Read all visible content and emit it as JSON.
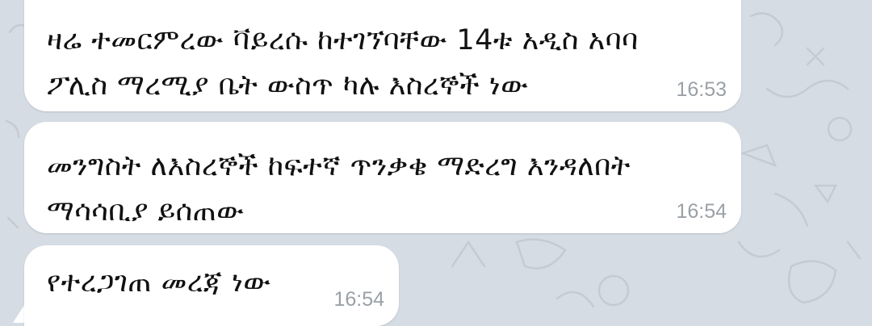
{
  "messages": [
    {
      "text": "ዛሬ ተመርምረው ቫይረሱ ከተገኘባቸው 14ቱ አዲስ አባባ\nፖሊስ ማረሚያ ቤት ውስጥ ካሉ እስረኞች ነው",
      "time": "16:53"
    },
    {
      "text": "መንግስት ለእስረኞች ከፍተኛ ጥንቃቄ ማድረግ እንዳለበት\nማሳሳቢያ ይሰጠው",
      "time": "16:54"
    },
    {
      "text": "የተረጋገጠ መረጃ ነው",
      "time": "16:54"
    }
  ],
  "colors": {
    "chat_background": "#d6dce3",
    "bubble": "#ffffff",
    "timestamp": "#9aa0a6"
  }
}
